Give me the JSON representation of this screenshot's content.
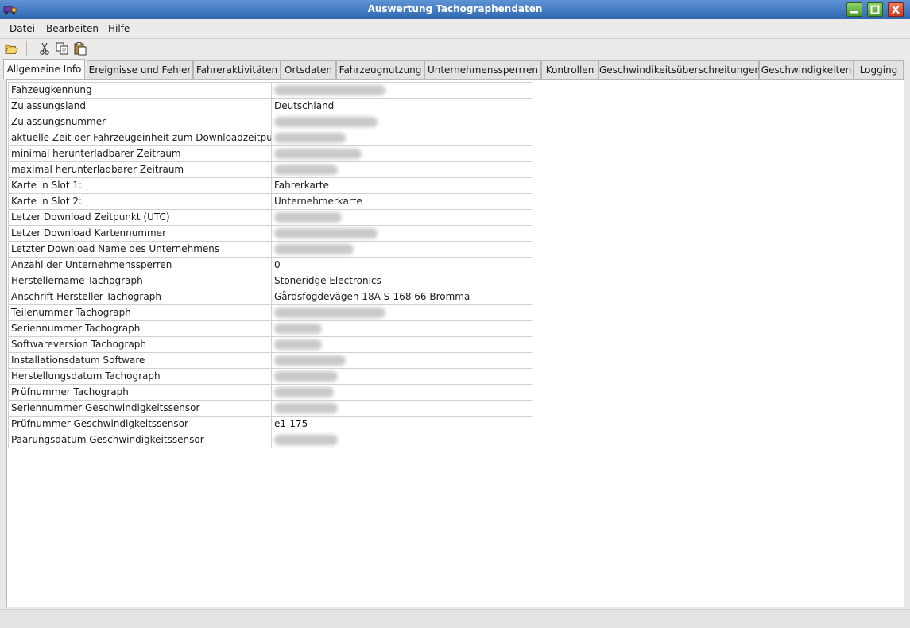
{
  "window": {
    "title": "Auswertung Tachographendaten"
  },
  "menu": [
    "Datei",
    "Bearbeiten",
    "Hilfe"
  ],
  "toolbar": [
    "open-folder-icon",
    "cut-icon",
    "copy-icon",
    "paste-icon"
  ],
  "tabs": [
    "Allgemeine Info",
    "Ereignisse und Fehler",
    "Fahreraktivitäten",
    "Ortsdaten",
    "Fahrzeugnutzung",
    "Unternehmenssperrren",
    "Kontrollen",
    "Geschwindikeitsüberschreitungen",
    "Geschwindigkeiten",
    "Logging"
  ],
  "info_rows": [
    {
      "label": "Fahzeugkennung",
      "value": null,
      "redacted": true
    },
    {
      "label": "Zulassungsland",
      "value": "Deutschland",
      "redacted": false
    },
    {
      "label": "Zulassungsnummer",
      "value": null,
      "redacted": true
    },
    {
      "label": "aktuelle Zeit der Fahrzeugeinheit zum Downloadzeitpunkt",
      "value": null,
      "redacted": true
    },
    {
      "label": "minimal herunterladbarer Zeitraum",
      "value": null,
      "redacted": true
    },
    {
      "label": "maximal herunterladbarer Zeitraum",
      "value": null,
      "redacted": true
    },
    {
      "label": "Karte in Slot 1:",
      "value": "Fahrerkarte",
      "redacted": false
    },
    {
      "label": "Karte in Slot 2:",
      "value": "Unternehmerkarte",
      "redacted": false
    },
    {
      "label": "Letzer Download Zeitpunkt (UTC)",
      "value": null,
      "redacted": true
    },
    {
      "label": "Letzer Download Kartennummer",
      "value": null,
      "redacted": true
    },
    {
      "label": "Letzter Download Name des Unternehmens",
      "value": null,
      "redacted": true
    },
    {
      "label": "Anzahl der Unternehmenssperren",
      "value": "0",
      "redacted": false
    },
    {
      "label": "Herstellername Tachograph",
      "value": "Stoneridge Electronics",
      "redacted": false
    },
    {
      "label": "Anschrift Hersteller Tachograph",
      "value": "Gårdsfogdevägen 18A S-168 66 Bromma",
      "redacted": false
    },
    {
      "label": "Teilenummer Tachograph",
      "value": null,
      "redacted": true
    },
    {
      "label": "Seriennummer Tachograph",
      "value": null,
      "redacted": true
    },
    {
      "label": "Softwareversion Tachograph",
      "value": null,
      "redacted": true
    },
    {
      "label": "Installationsdatum Software",
      "value": null,
      "redacted": true
    },
    {
      "label": "Herstellungsdatum Tachograph",
      "value": null,
      "redacted": true
    },
    {
      "label": "Prüfnummer Tachograph",
      "value": null,
      "redacted": true
    },
    {
      "label": "Seriennummer Geschwindigkeitssensor",
      "value": null,
      "redacted": true
    },
    {
      "label": "Prüfnummer Geschwindigkeitssensor",
      "value": "e1-175",
      "redacted": false
    },
    {
      "label": "Paarungsdatum Geschwindigkeitssensor",
      "value": null,
      "redacted": true
    }
  ],
  "colors": {
    "titlebar": "#2f68b2",
    "window_bg": "#e8e8e7",
    "panel_bg": "#ffffff",
    "grid": "#d0d0ce"
  }
}
